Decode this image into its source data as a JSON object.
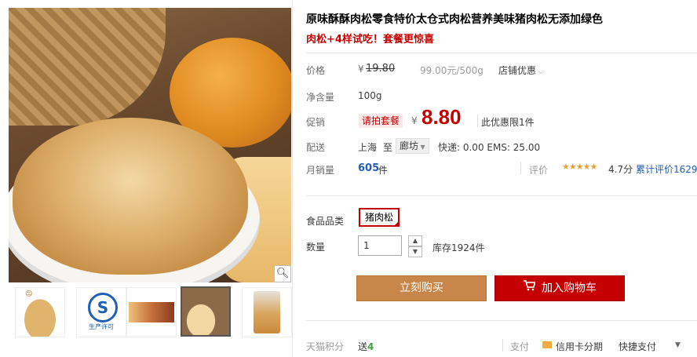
{
  "product": {
    "title": "原味酥酥肉松零食特价太仓式肉松营养美味猪肉松无添加绿色",
    "subtitle": "肉松+4样试吃！套餐更惊喜"
  },
  "gallery": {
    "zoom_icon": "magnifier-icon",
    "thumbs": [
      {
        "label": ""
      },
      {
        "label": "生产许可"
      },
      {
        "label": ""
      },
      {
        "label": ""
      },
      {
        "label": ""
      }
    ],
    "brand_mini": "☺"
  },
  "price": {
    "label": "价格",
    "currency": "¥",
    "original": "19.80",
    "unit_price": "99.00元/500g",
    "shop_discount": "店铺优惠"
  },
  "net": {
    "label": "净含量",
    "value": "100g"
  },
  "promo": {
    "label": "促销",
    "badge": "请拍套餐",
    "currency": "¥",
    "price": "8.80",
    "limit": "此优惠限1件"
  },
  "shipping": {
    "label": "配送",
    "from": "上海",
    "to_word": "至",
    "dest": "廊坊",
    "fee": "快递: 0.00 EMS: 25.00"
  },
  "sales": {
    "label": "月销量",
    "value": "605",
    "unit": "件",
    "rating_label": "评价",
    "stars": "★★★★★",
    "score": "4.7分",
    "reviews": "累计评价1629"
  },
  "options": {
    "label": "食品品类",
    "selected": "猪肉松"
  },
  "quantity": {
    "label": "数量",
    "value": "1",
    "up": "▲",
    "down": "▼",
    "stock": "库存1924件"
  },
  "actions": {
    "buy_now": "立刻购买",
    "add_cart": "加入购物车"
  },
  "footer": {
    "points_label": "天猫积分",
    "points_prefix": "送",
    "points_value": "4",
    "pay_label": "支付",
    "pay_card": "信用卡分期",
    "pay_quick": "快捷支付",
    "caret": "▼"
  },
  "colors": {
    "accent": "#c40000",
    "buy_now": "#c9864a",
    "link": "#1f5fb5"
  }
}
